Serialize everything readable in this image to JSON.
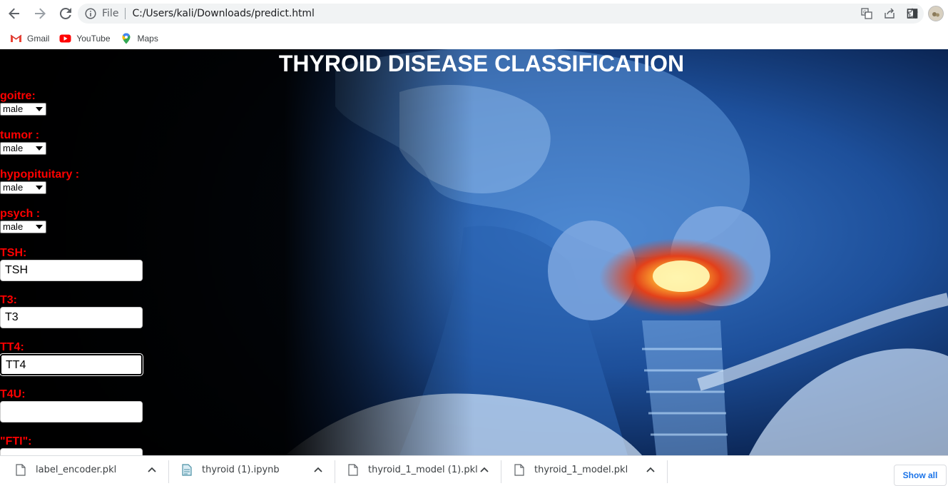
{
  "browser": {
    "address": {
      "scheme_label": "File",
      "url": "C:/Users/kali/Downloads/predict.html"
    },
    "bookmarks": [
      {
        "label": "Gmail",
        "icon": "gmail-icon"
      },
      {
        "label": "YouTube",
        "icon": "youtube-icon"
      },
      {
        "label": "Maps",
        "icon": "maps-icon"
      }
    ]
  },
  "page": {
    "title": "THYROID DISEASE CLASSIFICATION",
    "fields": [
      {
        "label": "goitre:",
        "type": "select",
        "value": "male"
      },
      {
        "label": "tumor :",
        "type": "select",
        "value": "male"
      },
      {
        "label": "hypopituitary :",
        "type": "select",
        "value": "male"
      },
      {
        "label": "psych :",
        "type": "select",
        "value": "male"
      },
      {
        "label": "TSH:",
        "type": "text",
        "value": "TSH"
      },
      {
        "label": "T3:",
        "type": "text",
        "value": "T3"
      },
      {
        "label": "TT4:",
        "type": "text",
        "value": "TT4"
      },
      {
        "label": "T4U:",
        "type": "text",
        "value": ""
      },
      {
        "label": "\"FTI\":",
        "type": "text",
        "value": ""
      }
    ]
  },
  "downloads": {
    "items": [
      {
        "name": "label_encoder.pkl",
        "icon": "file-icon"
      },
      {
        "name": "thyroid (1).ipynb",
        "icon": "notebook-file-icon"
      },
      {
        "name": "thyroid_1_model (1).pkl",
        "icon": "file-icon"
      },
      {
        "name": "thyroid_1_model.pkl",
        "icon": "file-icon"
      }
    ],
    "show_all_label": "Show all"
  },
  "colors": {
    "label_red": "#ff0000",
    "title_white": "#ffffff",
    "link_blue": "#1a73e8"
  }
}
